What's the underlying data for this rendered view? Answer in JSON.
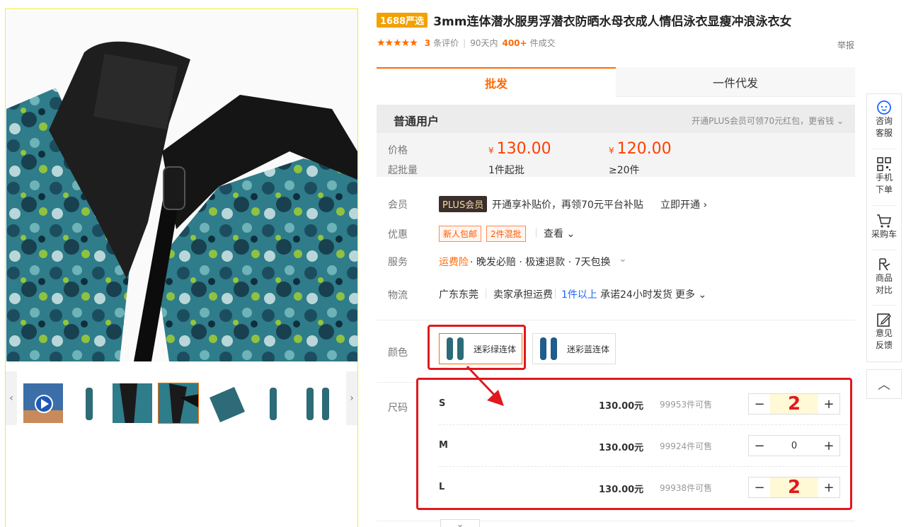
{
  "gallery": {
    "thumb_count": 8,
    "active_thumb": 3
  },
  "product": {
    "tag": "1688严选",
    "title": "3mm连体潜水服男浮潜衣防晒水母衣成人情侣泳衣显瘦冲浪泳衣女",
    "stars": "★★★★★",
    "review_count": "3",
    "review_label": "条评价",
    "period": "90天内",
    "sold_count": "400+",
    "sold_label": "件成交",
    "report": "举报"
  },
  "tabs": [
    {
      "label": "批发",
      "active": true
    },
    {
      "label": "一件代发",
      "active": false
    }
  ],
  "price_box": {
    "user_type": "普通用户",
    "plus_hint": "开通PLUS会员可领70元红包，更省钱",
    "price_label": "价格",
    "moq_label": "起批量",
    "currency": "¥",
    "tiers": [
      {
        "price": "130.00",
        "moq": "1件起批"
      },
      {
        "price": "120.00",
        "moq": "≥20件"
      }
    ]
  },
  "info": {
    "member_label": "会员",
    "plus_badge": "PLUS会员",
    "member_text": "开通享补贴价，再领70元平台补贴",
    "member_link": "立即开通",
    "promo_label": "优惠",
    "promo_badges": [
      "新人包邮",
      "2件混批"
    ],
    "promo_more": "查看",
    "service_label": "服务",
    "service_insurance": "运费险",
    "service_text": "· 晚发必赔 · 极速退款 · 7天包换",
    "logistics_label": "物流",
    "origin": "广东东莞",
    "freight": "卖家承担运费",
    "min_qty": "1件以上",
    "promise": "承诺24小时发货",
    "more": "更多"
  },
  "colors": {
    "label": "颜色",
    "options": [
      {
        "name": "迷彩绿连体",
        "selected": true
      },
      {
        "name": "迷彩蓝连体",
        "selected": false
      }
    ]
  },
  "sizes": {
    "label": "尺码",
    "rows": [
      {
        "size": "S",
        "price": "130.00元",
        "stock": "99953件可售",
        "qty": "2",
        "highlight": true
      },
      {
        "size": "M",
        "price": "130.00元",
        "stock": "99924件可售",
        "qty": "0",
        "highlight": false
      },
      {
        "size": "L",
        "price": "130.00元",
        "stock": "99938件可售",
        "qty": "2",
        "highlight": true
      }
    ],
    "minus": "−",
    "plus": "+"
  },
  "sidebar": {
    "items": [
      {
        "label1": "咨询",
        "label2": "客服",
        "icon": "chat-icon"
      },
      {
        "label1": "手机",
        "label2": "下单",
        "icon": "qrcode-icon"
      },
      {
        "label1": "采购车",
        "label2": "",
        "icon": "cart-icon"
      },
      {
        "label1": "商品",
        "label2": "对比",
        "icon": "compare-icon"
      },
      {
        "label1": "意见",
        "label2": "反馈",
        "icon": "feedback-icon"
      }
    ],
    "to_top": "︿"
  },
  "colors_theme": {
    "accent": "#ff6a00",
    "price_red": "#ff4000",
    "annotation_red": "#e0191f"
  }
}
